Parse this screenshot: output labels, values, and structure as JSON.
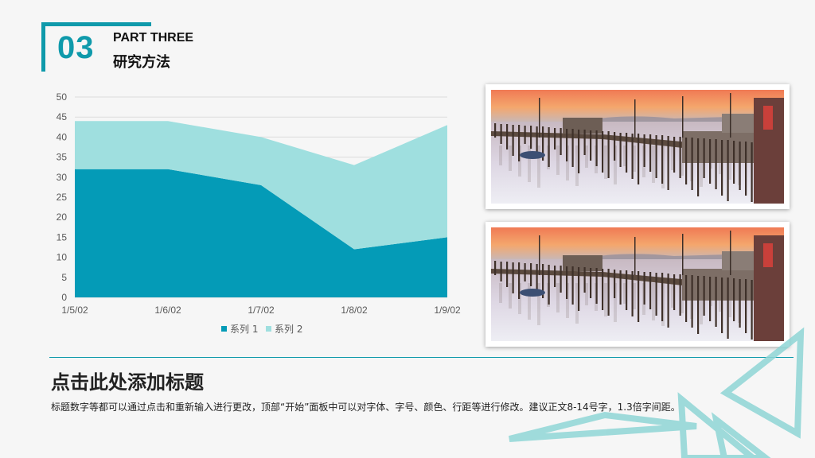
{
  "header": {
    "number": "03",
    "part": "PART THREE",
    "subtitle": "研究方法"
  },
  "colors": {
    "accent": "#0f9aab",
    "series1": "#049bb7",
    "series2": "#9fdfdf"
  },
  "chart_data": {
    "type": "area",
    "stacked": true,
    "categories": [
      "1/5/02",
      "1/6/02",
      "1/7/02",
      "1/8/02",
      "1/9/02"
    ],
    "series": [
      {
        "name": "系列 1",
        "values": [
          32,
          32,
          28,
          12,
          15
        ]
      },
      {
        "name": "系列 2",
        "values": [
          12,
          12,
          12,
          21,
          28
        ]
      }
    ],
    "ylim": [
      0,
      50
    ],
    "yticks": [
      0,
      5,
      10,
      15,
      20,
      25,
      30,
      35,
      40,
      45,
      50
    ],
    "grid": true,
    "legend": "bottom"
  },
  "photos": [
    {
      "name": "pier-photo-top"
    },
    {
      "name": "pier-photo-bottom"
    }
  ],
  "content": {
    "headline": "点击此处添加标题",
    "body": "标题数字等都可以通过点击和重新输入进行更改，顶部“开始”面板中可以对字体、字号、颜色、行距等进行修改。建议正文8-14号字，1.3倍字间距。"
  }
}
